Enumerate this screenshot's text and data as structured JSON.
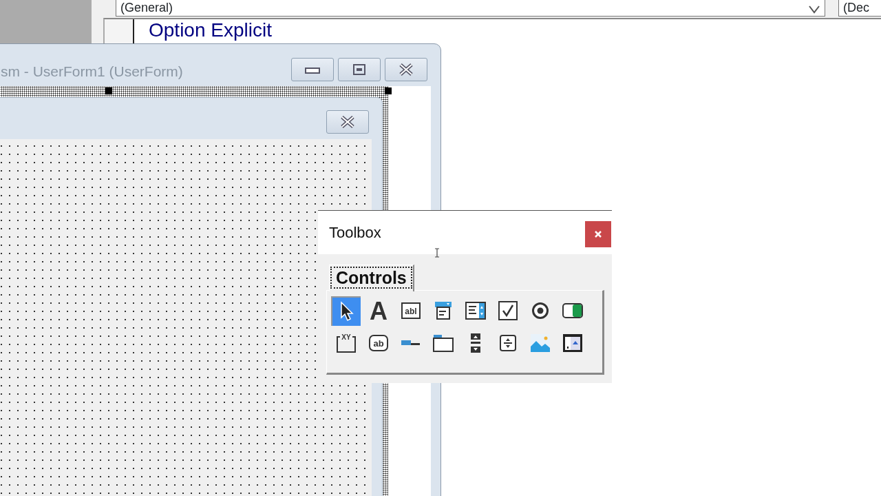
{
  "code_window": {
    "object_dropdown": "(General)",
    "procedure_dropdown": "(Dec",
    "code_lines": [
      "Option Explicit"
    ]
  },
  "designer_window": {
    "title": "sm - UserForm1 (UserForm)",
    "buttons": [
      {
        "kind": "minimize"
      },
      {
        "kind": "restore"
      },
      {
        "kind": "close"
      }
    ]
  },
  "toolbox": {
    "title": "Toolbox",
    "tabs": [
      {
        "label": "Controls",
        "selected": true
      }
    ],
    "tools": [
      {
        "kind": "pointer",
        "selected": true
      },
      {
        "kind": "label",
        "glyph": "A",
        "selected": false
      },
      {
        "kind": "textbox",
        "glyph": "abl",
        "selected": false
      },
      {
        "kind": "combobox",
        "selected": false
      },
      {
        "kind": "listbox",
        "selected": false
      },
      {
        "kind": "checkbox",
        "selected": false
      },
      {
        "kind": "option",
        "selected": false
      },
      {
        "kind": "toggle",
        "selected": false
      },
      {
        "kind": "frame",
        "glyph": "XY",
        "selected": false
      },
      {
        "kind": "button",
        "glyph": "ab",
        "selected": false
      },
      {
        "kind": "tabstrip",
        "selected": false
      },
      {
        "kind": "multipage",
        "selected": false
      },
      {
        "kind": "scrollbar",
        "selected": false
      },
      {
        "kind": "spin",
        "selected": false
      },
      {
        "kind": "image",
        "selected": false
      },
      {
        "kind": "refedit",
        "selected": false
      }
    ]
  }
}
